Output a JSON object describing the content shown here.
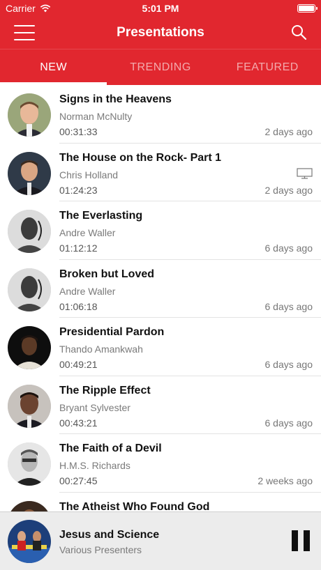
{
  "status_bar": {
    "carrier": "Carrier",
    "time": "5:01 PM"
  },
  "nav": {
    "title": "Presentations",
    "menu_icon": "hamburger-menu-icon",
    "search_icon": "search-icon"
  },
  "tabs": [
    {
      "label": "NEW",
      "active": true
    },
    {
      "label": "TRENDING",
      "active": false
    },
    {
      "label": "FEATURED",
      "active": false
    }
  ],
  "presentations": [
    {
      "title": "Signs in the Heavens",
      "presenter": "Norman McNulty",
      "duration": "00:31:33",
      "date": "2 days ago"
    },
    {
      "title": "The House on the Rock- Part 1",
      "presenter": "Chris Holland",
      "duration": "01:24:23",
      "date": "2 days ago",
      "icon": "tv-icon"
    },
    {
      "title": "The Everlasting",
      "presenter": "Andre Waller",
      "duration": "01:12:12",
      "date": "6 days ago"
    },
    {
      "title": "Broken but Loved",
      "presenter": "Andre Waller",
      "duration": "01:06:18",
      "date": "6 days ago"
    },
    {
      "title": "Presidential Pardon",
      "presenter": "Thando Amankwah",
      "duration": "00:49:21",
      "date": "6 days ago"
    },
    {
      "title": "The Ripple Effect",
      "presenter": "Bryant Sylvester",
      "duration": "00:43:21",
      "date": "6 days ago"
    },
    {
      "title": "The Faith of a Devil",
      "presenter": "H.M.S. Richards",
      "duration": "00:27:45",
      "date": "2 weeks ago"
    },
    {
      "title": "The Atheist Who Found God",
      "presenter": "",
      "duration": "",
      "date": ""
    }
  ],
  "now_playing": {
    "title": "Jesus and Science",
    "presenter": "Various Presenters",
    "control_icon": "pause-icon"
  },
  "colors": {
    "brand": "#e1272f",
    "player_bg": "#ececec"
  }
}
